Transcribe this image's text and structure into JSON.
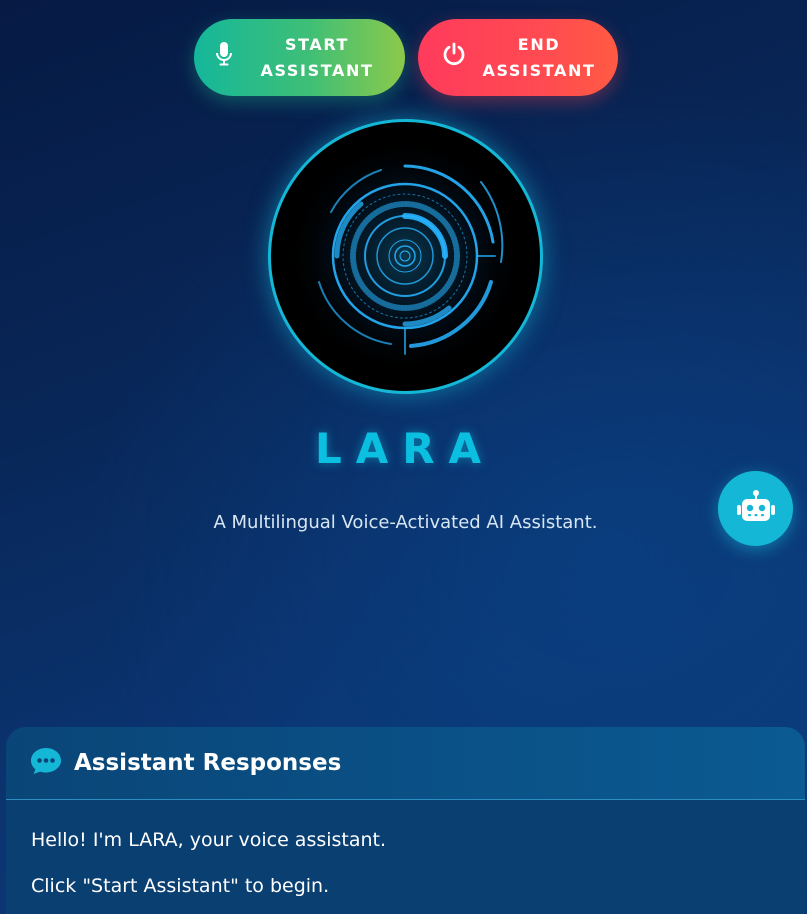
{
  "controls": {
    "start_label": "START\nASSISTANT",
    "end_label": "END\nASSISTANT",
    "start_icon": "microphone-icon",
    "end_icon": "power-icon"
  },
  "assistant": {
    "name": "LARA",
    "tagline": "A Multilingual Voice-Activated AI Assistant."
  },
  "fab": {
    "icon": "robot-icon"
  },
  "responses": {
    "title": "Assistant Responses",
    "icon": "chat-bubble-icon",
    "messages": [
      "Hello! I'm LARA, your voice assistant.",
      "Click \"Start Assistant\" to begin."
    ]
  },
  "colors": {
    "accent": "#14b8d6",
    "start_gradient": [
      "#14b79b",
      "#8cc94b"
    ],
    "end_gradient": [
      "#ff3b5c",
      "#ff5a43"
    ],
    "background": "#082657"
  }
}
